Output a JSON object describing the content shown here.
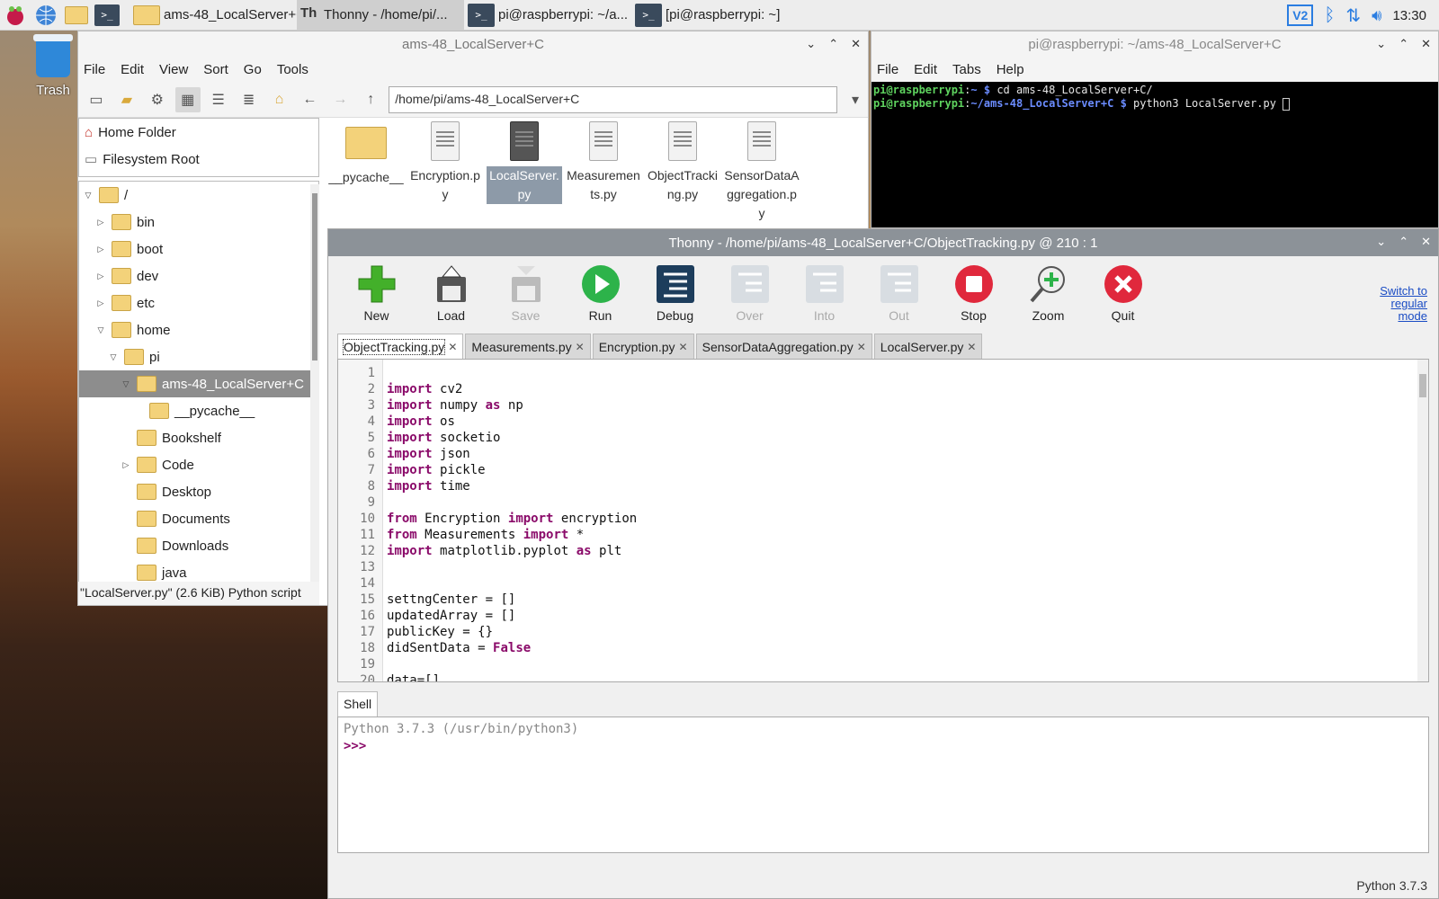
{
  "taskbar": {
    "windows": [
      {
        "label": "ams-48_LocalServer+C",
        "type": "folder",
        "active": false
      },
      {
        "label": "Thonny  -  /home/pi/...",
        "type": "thonny",
        "active": true
      },
      {
        "label": "pi@raspberrypi: ~/a...",
        "type": "terminal",
        "active": false
      },
      {
        "label": "[pi@raspberrypi: ~]",
        "type": "terminal",
        "active": false
      }
    ],
    "clock": "13:30"
  },
  "desktop": {
    "trash_label": "Trash"
  },
  "file_manager": {
    "title": "ams-48_LocalServer+C",
    "menu": [
      "File",
      "Edit",
      "View",
      "Sort",
      "Go",
      "Tools"
    ],
    "address": "/home/pi/ams-48_LocalServer+C",
    "places": [
      "Home Folder",
      "Filesystem Root"
    ],
    "tree": [
      {
        "label": "/",
        "depth": 0,
        "expander": "open"
      },
      {
        "label": "bin",
        "depth": 1,
        "expander": "closed"
      },
      {
        "label": "boot",
        "depth": 1,
        "expander": "closed"
      },
      {
        "label": "dev",
        "depth": 1,
        "expander": "closed"
      },
      {
        "label": "etc",
        "depth": 1,
        "expander": "closed"
      },
      {
        "label": "home",
        "depth": 1,
        "expander": "open"
      },
      {
        "label": "pi",
        "depth": 2,
        "expander": "open"
      },
      {
        "label": "ams-48_LocalServer+C",
        "depth": 3,
        "expander": "open",
        "selected": true
      },
      {
        "label": "__pycache__",
        "depth": 4,
        "expander": "none"
      },
      {
        "label": "Bookshelf",
        "depth": 3,
        "expander": "none"
      },
      {
        "label": "Code",
        "depth": 3,
        "expander": "closed"
      },
      {
        "label": "Desktop",
        "depth": 3,
        "expander": "none"
      },
      {
        "label": "Documents",
        "depth": 3,
        "expander": "none"
      },
      {
        "label": "Downloads",
        "depth": 3,
        "expander": "none"
      },
      {
        "label": "java",
        "depth": 3,
        "expander": "none"
      }
    ],
    "files": [
      {
        "name": "__pycache__",
        "kind": "folder"
      },
      {
        "name": "Encryption.py",
        "kind": "file"
      },
      {
        "name": "LocalServer.py",
        "kind": "file",
        "selected": true
      },
      {
        "name": "Measurements.py",
        "kind": "file"
      },
      {
        "name": "ObjectTracking.py",
        "kind": "file"
      },
      {
        "name": "SensorDataAggregation.py",
        "kind": "file"
      }
    ],
    "status": "\"LocalServer.py\" (2.6 KiB) Python script"
  },
  "terminal": {
    "title": "pi@raspberrypi: ~/ams-48_LocalServer+C",
    "menu": [
      "File",
      "Edit",
      "Tabs",
      "Help"
    ],
    "lines": [
      {
        "user": "pi@raspberrypi",
        "path": "~",
        "cmd": "cd ams-48_LocalServer+C/"
      },
      {
        "user": "pi@raspberrypi",
        "path": "~/ams-48_LocalServer+C",
        "cmd": "python3 LocalServer.py "
      }
    ]
  },
  "thonny": {
    "title": "Thonny  -  /home/pi/ams-48_LocalServer+C/ObjectTracking.py  @  210 : 1",
    "toolbar": [
      {
        "label": "New",
        "icon": "new-icon",
        "enabled": true
      },
      {
        "label": "Load",
        "icon": "load-icon",
        "enabled": true
      },
      {
        "label": "Save",
        "icon": "save-icon",
        "enabled": false
      },
      {
        "label": "Run",
        "icon": "run-icon",
        "enabled": true
      },
      {
        "label": "Debug",
        "icon": "debug-icon",
        "enabled": true
      },
      {
        "label": "Over",
        "icon": "step-over-icon",
        "enabled": false
      },
      {
        "label": "Into",
        "icon": "step-into-icon",
        "enabled": false
      },
      {
        "label": "Out",
        "icon": "step-out-icon",
        "enabled": false
      },
      {
        "label": "Stop",
        "icon": "stop-icon",
        "enabled": true
      },
      {
        "label": "Zoom",
        "icon": "zoom-icon",
        "enabled": true
      },
      {
        "label": "Quit",
        "icon": "quit-icon",
        "enabled": true
      }
    ],
    "switch_mode": "Switch to regular mode",
    "tabs": [
      "ObjectTracking.py",
      "Measurements.py",
      "Encryption.py",
      "SensorDataAggregation.py",
      "LocalServer.py"
    ],
    "active_tab": 0,
    "code": [
      "",
      "import cv2",
      "import numpy as np",
      "import os",
      "import socketio",
      "import json",
      "import pickle",
      "import time",
      "",
      "from Encryption import encryption",
      "from Measurements import *",
      "import matplotlib.pyplot as plt",
      "",
      "",
      "settngCenter = []",
      "updatedArray = []",
      "publicKey = {}",
      "didSentData = False",
      "",
      "data=[]"
    ],
    "shell_tab": "Shell",
    "shell_info": "Python 3.7.3 (/usr/bin/python3)",
    "shell_prompt": ">>>",
    "status": "Python 3.7.3"
  },
  "colors": {
    "thonny_title": "#8c9298",
    "keyword": "#8a0a69",
    "terminal_user": "#5fd35f",
    "terminal_path": "#6b8cff"
  }
}
